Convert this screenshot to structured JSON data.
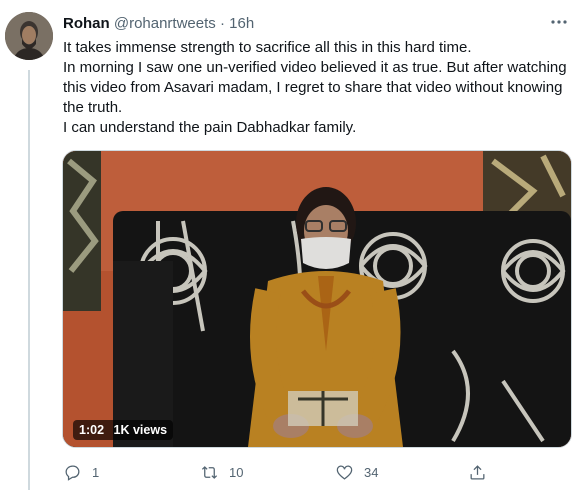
{
  "tweet": {
    "author_name": "Rohan",
    "author_handle": "@rohanrtweets",
    "separator": "·",
    "time": "16h",
    "lines": [
      "It takes immense strength to sacrifice all this in this hard time.",
      "In morning I saw one un-verified video believed it as true. But after watching this video from Asavari madam, I regret to share that video without knowing the truth.",
      "I can understand the pain Dabhadkar family."
    ]
  },
  "media": {
    "duration": "1:02",
    "views": "1K views"
  },
  "actions": {
    "reply": {
      "icon": "reply-icon",
      "count": "1"
    },
    "retweet": {
      "icon": "retweet-icon",
      "count": "10"
    },
    "like": {
      "icon": "heart-icon",
      "count": "34"
    },
    "share": {
      "icon": "share-icon"
    }
  },
  "colors": {
    "text": "#0f1419",
    "muted": "#536471",
    "border": "#cfd9de"
  }
}
